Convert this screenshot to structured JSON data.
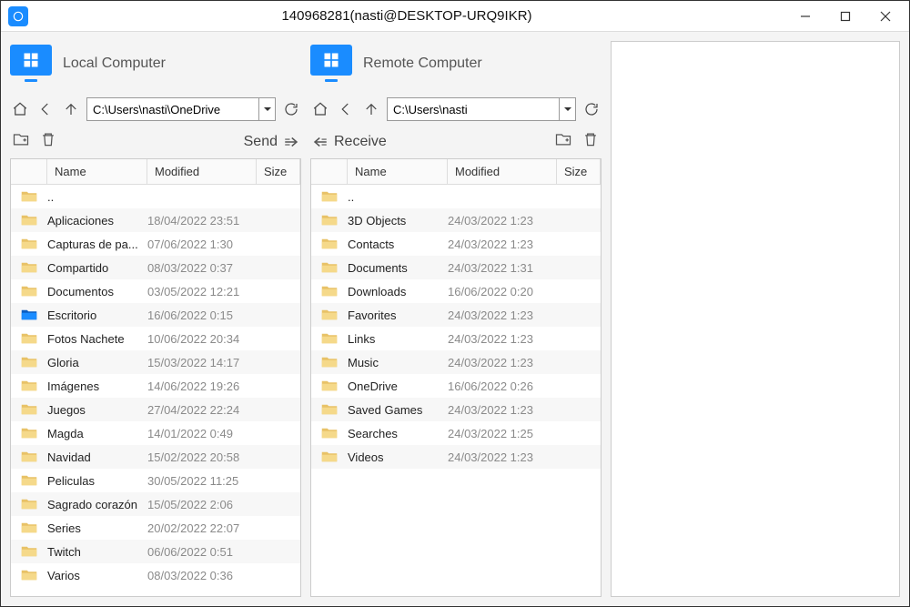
{
  "window": {
    "title": "140968281(nasti@DESKTOP-URQ9IKR)"
  },
  "local": {
    "title": "Local Computer",
    "path": "C:\\Users\\nasti\\OneDrive",
    "action": "Send",
    "columns": {
      "name": "Name",
      "modified": "Modified",
      "size": "Size"
    },
    "rows": [
      {
        "name": "..",
        "mod": "",
        "icon": "folder"
      },
      {
        "name": "Aplicaciones",
        "mod": "18/04/2022 23:51",
        "icon": "folder"
      },
      {
        "name": "Capturas de pa...",
        "mod": "07/06/2022 1:30",
        "icon": "folder"
      },
      {
        "name": "Compartido",
        "mod": "08/03/2022 0:37",
        "icon": "folder"
      },
      {
        "name": "Documentos",
        "mod": "03/05/2022 12:21",
        "icon": "folder"
      },
      {
        "name": "Escritorio",
        "mod": "16/06/2022 0:15",
        "icon": "desktop"
      },
      {
        "name": "Fotos Nachete",
        "mod": "10/06/2022 20:34",
        "icon": "folder"
      },
      {
        "name": "Gloria",
        "mod": "15/03/2022 14:17",
        "icon": "folder"
      },
      {
        "name": "Imágenes",
        "mod": "14/06/2022 19:26",
        "icon": "folder"
      },
      {
        "name": "Juegos",
        "mod": "27/04/2022 22:24",
        "icon": "folder"
      },
      {
        "name": "Magda",
        "mod": "14/01/2022 0:49",
        "icon": "folder"
      },
      {
        "name": "Navidad",
        "mod": "15/02/2022 20:58",
        "icon": "folder"
      },
      {
        "name": "Peliculas",
        "mod": "30/05/2022 11:25",
        "icon": "folder"
      },
      {
        "name": "Sagrado corazón",
        "mod": "15/05/2022 2:06",
        "icon": "folder"
      },
      {
        "name": "Series",
        "mod": "20/02/2022 22:07",
        "icon": "folder"
      },
      {
        "name": "Twitch",
        "mod": "06/06/2022 0:51",
        "icon": "folder"
      },
      {
        "name": "Varios",
        "mod": "08/03/2022 0:36",
        "icon": "folder"
      }
    ]
  },
  "remote": {
    "title": "Remote Computer",
    "path": "C:\\Users\\nasti",
    "action": "Receive",
    "columns": {
      "name": "Name",
      "modified": "Modified",
      "size": "Size"
    },
    "rows": [
      {
        "name": "..",
        "mod": "",
        "icon": "folder"
      },
      {
        "name": "3D Objects",
        "mod": "24/03/2022 1:23",
        "icon": "folder"
      },
      {
        "name": "Contacts",
        "mod": "24/03/2022 1:23",
        "icon": "folder"
      },
      {
        "name": "Documents",
        "mod": "24/03/2022 1:31",
        "icon": "folder"
      },
      {
        "name": "Downloads",
        "mod": "16/06/2022 0:20",
        "icon": "folder"
      },
      {
        "name": "Favorites",
        "mod": "24/03/2022 1:23",
        "icon": "folder"
      },
      {
        "name": "Links",
        "mod": "24/03/2022 1:23",
        "icon": "folder"
      },
      {
        "name": "Music",
        "mod": "24/03/2022 1:23",
        "icon": "folder"
      },
      {
        "name": "OneDrive",
        "mod": "16/06/2022 0:26",
        "icon": "folder"
      },
      {
        "name": "Saved Games",
        "mod": "24/03/2022 1:23",
        "icon": "folder"
      },
      {
        "name": "Searches",
        "mod": "24/03/2022 1:25",
        "icon": "folder"
      },
      {
        "name": "Videos",
        "mod": "24/03/2022 1:23",
        "icon": "folder"
      }
    ]
  }
}
